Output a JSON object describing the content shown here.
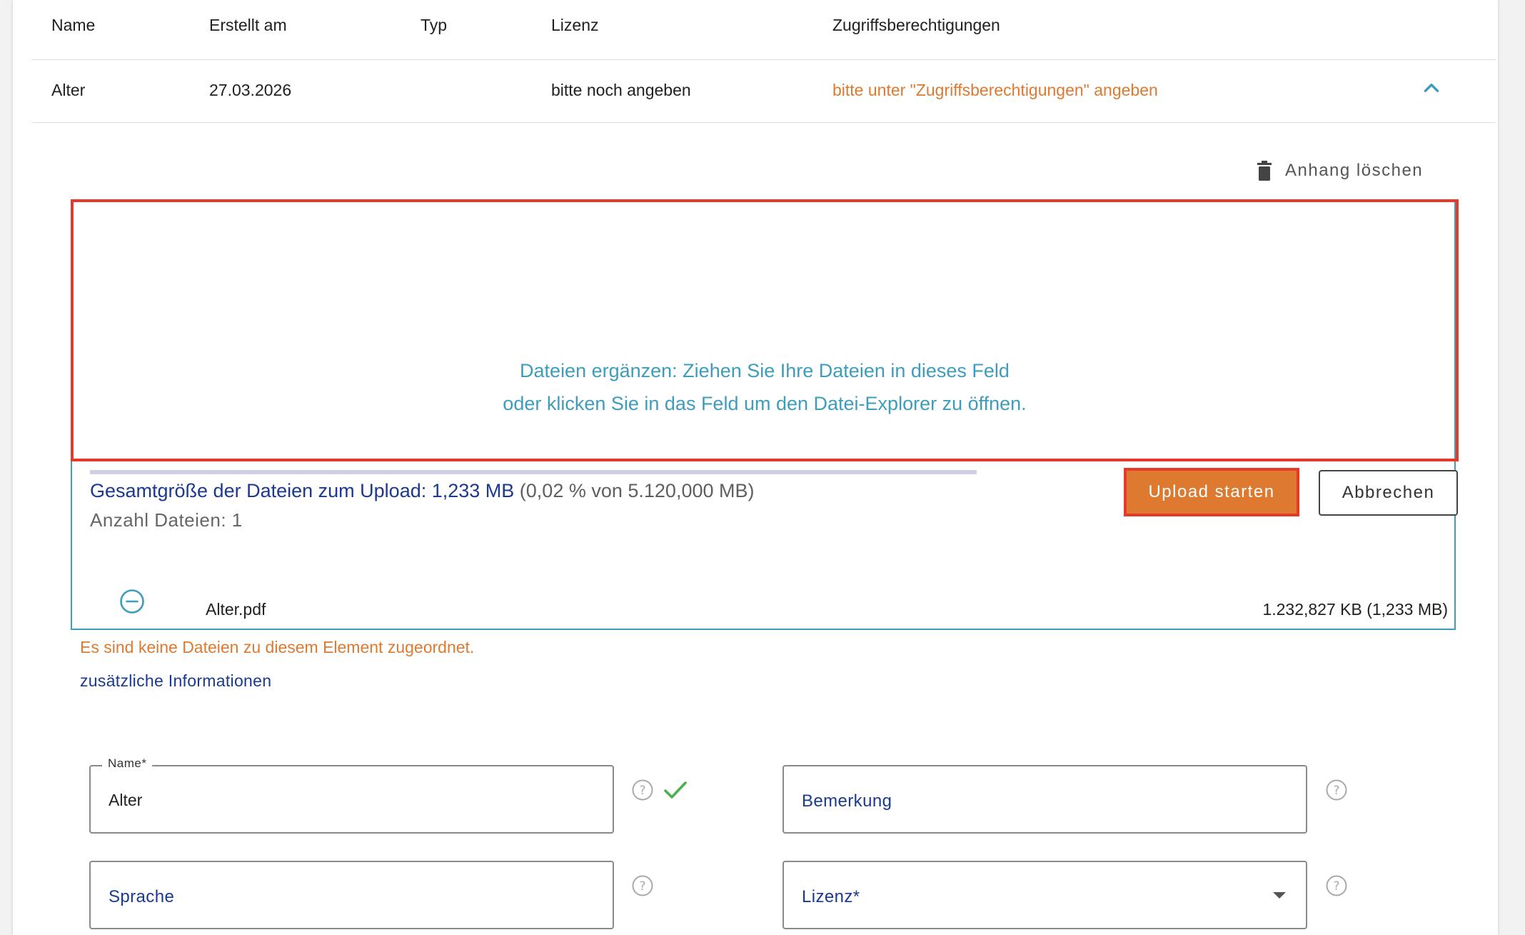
{
  "table": {
    "headers": {
      "name": "Name",
      "created": "Erstellt am",
      "type": "Typ",
      "license": "Lizenz",
      "permissions": "Zugriffsberechtigungen"
    },
    "row": {
      "name": "Alter",
      "created": "27.03.2026",
      "type": "",
      "license": "bitte noch angeben",
      "permissions": "bitte unter \"Zugriffsberechtigungen\" angeben"
    }
  },
  "attachment": {
    "delete_label": "Anhang löschen"
  },
  "dropzone": {
    "line1": "Dateien ergänzen: Ziehen Sie Ihre Dateien in dieses Feld",
    "line2": "oder klicken Sie in das Feld um den Datei-Explorer zu öffnen."
  },
  "upload": {
    "total_label": "Gesamtgröße der Dateien zum Upload: 1,233 MB",
    "total_quota": " (0,02 % von 5.120,000 MB)",
    "count_label": "Anzahl Dateien: 1",
    "progress_fraction": 0,
    "start_button": "Upload starten",
    "cancel_button": "Abbrechen",
    "files": [
      {
        "name": "Alter.pdf",
        "size": "1.232,827 KB (1,233 MB)"
      }
    ]
  },
  "messages": {
    "no_files": "Es sind keine Dateien zu diesem Element zugeordnet.",
    "additional_info": "zusätzliche Informationen"
  },
  "form": {
    "name": {
      "label": "Name*",
      "value": "Alter"
    },
    "remark": {
      "placeholder": "Bemerkung"
    },
    "language": {
      "placeholder": "Sprache"
    },
    "license": {
      "placeholder": "Lizenz*"
    }
  },
  "colors": {
    "accent_orange": "#dd7a30",
    "highlight_red": "#e53a2a",
    "dropzone_teal": "#3d9dbb",
    "link_blue": "#1a3a8f",
    "success_green": "#4caf50"
  }
}
